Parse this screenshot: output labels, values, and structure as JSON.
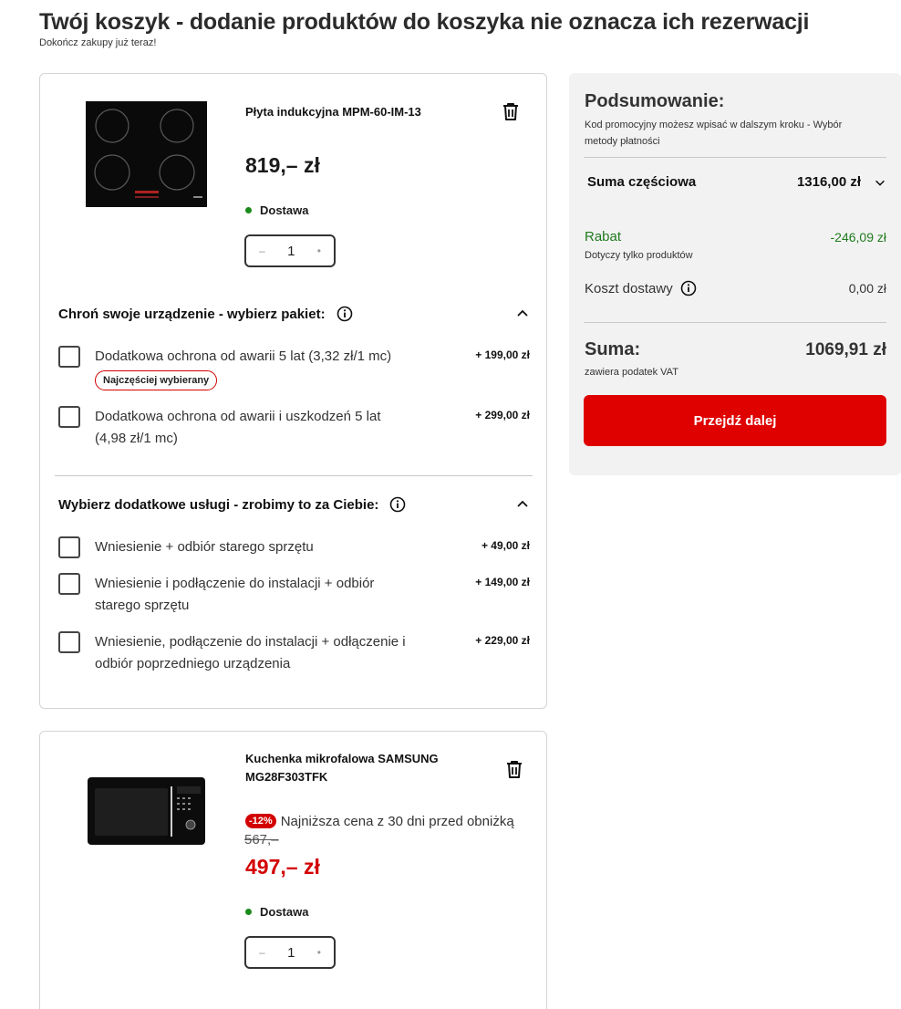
{
  "header": {
    "title": "Twój koszyk - dodanie produktów do koszyka nie oznacza ich rezerwacji",
    "subtitle": "Dokończ zakupy już teraz!"
  },
  "cart": {
    "items": [
      {
        "name": "Płyta indukcyjna MPM-60-IM-13",
        "price": "819,– zł",
        "delivery": "Dostawa",
        "quantity": "1",
        "protection": {
          "title": "Chroń swoje urządzenie - wybierz pakiet:",
          "options": [
            {
              "label": "Dodatkowa ochrona od awarii 5 lat (3,32 zł/1 mc)",
              "price": "+ 199,00 zł",
              "badge": "Najczęściej wybierany"
            },
            {
              "label": "Dodatkowa ochrona od awarii i uszkodzeń 5 lat (4,98 zł/1 mc)",
              "price": "+ 299,00 zł"
            }
          ]
        },
        "services": {
          "title": "Wybierz dodatkowe usługi - zrobimy to za Ciebie:",
          "options": [
            {
              "label": "Wniesienie + odbiór starego sprzętu",
              "price": "+ 49,00 zł"
            },
            {
              "label": "Wniesienie i podłączenie do instalacji + odbiór starego sprzętu",
              "price": "+ 149,00 zł"
            },
            {
              "label": "Wniesienie, podłączenie do instalacji + odłączenie i odbiór poprzedniego urządzenia",
              "price": "+ 229,00 zł"
            }
          ]
        }
      },
      {
        "name": "Kuchenka mikrofalowa SAMSUNG MG28F303TFK",
        "discount_badge": "-12%",
        "lowest_price_note": "Najniższa cena z 30 dni przed obniżką",
        "old_price": "567,–",
        "price": "497,– zł",
        "delivery": "Dostawa",
        "quantity": "1"
      }
    ]
  },
  "summary": {
    "title": "Podsumowanie:",
    "promo_note": "Kod promocyjny możesz wpisać w dalszym kroku - Wybór metody płatności",
    "subtotal_label": "Suma częściowa",
    "subtotal_value": "1316,00 zł",
    "discount_label": "Rabat",
    "discount_value": "-246,09 zł",
    "discount_note": "Dotyczy tylko produktów",
    "shipping_label": "Koszt dostawy",
    "shipping_value": "0,00 zł",
    "total_label": "Suma:",
    "total_value": "1069,91 zł",
    "vat_note": "zawiera podatek VAT",
    "cta_label": "Przejdź dalej"
  },
  "icons": {
    "trash": "trash-icon",
    "info": "info-icon",
    "chevron_up": "chevron-up-icon",
    "chevron_down": "chevron-down-icon"
  },
  "colors": {
    "accent_red": "#df0000",
    "discount_green": "#1f7a1f",
    "delivery_dot": "#1a8a1a"
  }
}
